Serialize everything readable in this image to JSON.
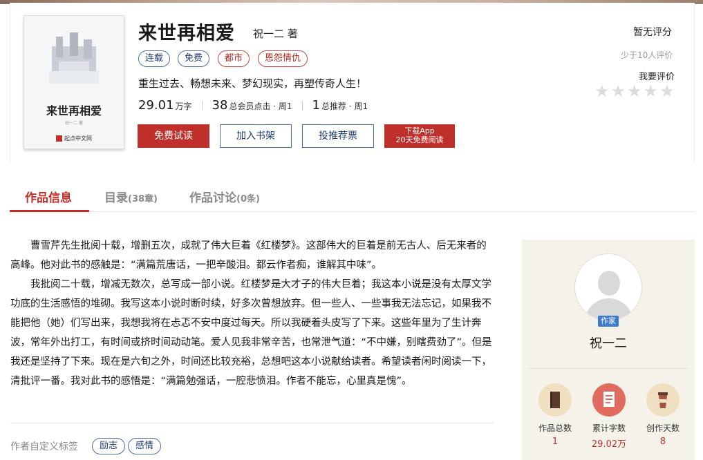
{
  "book": {
    "title": "来世再相爱",
    "author": "祝一二 著",
    "tags": [
      "连载",
      "免费",
      "都市",
      "恩怨情仇"
    ],
    "intro": "重生过去、畅想未来、梦幻现实，再塑传奇人生！",
    "stats": [
      {
        "value": "29.01",
        "unit": "万字"
      },
      {
        "value": "38",
        "unit": "总会员点击 · 周1"
      },
      {
        "value": "1",
        "unit": "总推荐 · 周1"
      }
    ]
  },
  "cover": {
    "title": "来世再相爱",
    "author": "祝一二 著",
    "logo": "起点中文网"
  },
  "buttons": {
    "free_read": "免费试读",
    "add_shelf": "加入书架",
    "vote": "投推荐票",
    "app_line1": "下载App",
    "app_line2": "20天免费阅读"
  },
  "rating": {
    "label": "暂无评分",
    "count": "少于10人评价",
    "rate": "我要评价",
    "stars": 5
  },
  "tabs": [
    {
      "label": "作品信息",
      "count": ""
    },
    {
      "label": "目录",
      "count": "(38章)"
    },
    {
      "label": "作品讨论",
      "count": "(0条)"
    }
  ],
  "description": [
    "曹雪芹先生批阅十载，增删五次，成就了伟大巨着《红楼梦》。这部伟大的巨着是前无古人、后无来者的高峰。他对此书的感触是：“满篇荒唐话，一把辛酸泪。都云作者痴，谁解其中味”。",
    "我批阅二十载，增减无数次，总写成一部小说。红楼梦是大才子的伟大巨着；我这本小说是没有太厚文学功底的生活感悟的堆砌。我写这本小说时断时续，好多次曾想放弃。但一些人、一些事我无法忘记，如果我不能把他（她）们写出来，我想我将在忐忑不安中度过每天。所以我硬着头皮写了下来。这些年里为了生计奔波，常年外出打工，有时间或挤时间动动笔。爱人见我非常辛苦，也常泄气道：“不中嫌，别瞎费劲了”。但是我还是坚持了下来。现在是六旬之外，时间还比较充裕，总想吧这本小说献给读者。希望读者闲时阅读一下，清批评一番。我对此书的感悟是：“满篇勉强话，一腔悲愤泪。作者不能忘，心里真是愧”。"
  ],
  "custom_tags": {
    "label": "作者自定义标签",
    "items": [
      "励志",
      "感情"
    ]
  },
  "author_panel": {
    "badge": "作家",
    "name": "祝一二",
    "stats": [
      {
        "label": "作品总数",
        "value": "1",
        "icon": "book-icon",
        "color": "#f0dfc0"
      },
      {
        "label": "累计字数",
        "value": "29.02万",
        "icon": "document-icon",
        "color": "#e26b5f"
      },
      {
        "label": "创作天数",
        "value": "8",
        "icon": "coffee-cup-icon",
        "color": "#f0dfc0"
      }
    ]
  }
}
